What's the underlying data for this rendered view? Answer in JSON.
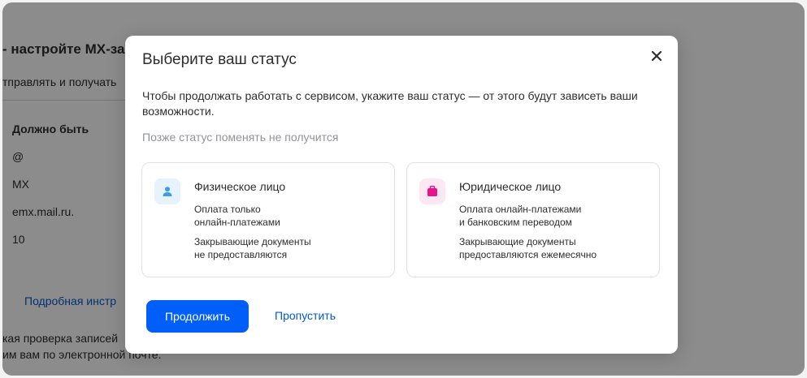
{
  "background": {
    "title": "- настройте MX-за",
    "subtitle": "тправлять и получать",
    "column_header": "Должно быть",
    "cells": [
      "@",
      "MX",
      "emx.mail.ru.",
      "10"
    ],
    "link": "Подробная инстр",
    "note_line1": "кая проверка записей",
    "note_line2": "им вам по электронной почте."
  },
  "modal": {
    "title": "Выберите ваш статус",
    "description": "Чтобы продолжать работать с сервисом, укажите ваш статус — от этого будут зависеть ваши возможности.",
    "hint": "Позже статус поменять не получится",
    "cards": [
      {
        "title": "Физическое лицо",
        "icon": "person-icon",
        "lines": [
          "Оплата только",
          "онлайн-платежами",
          "Закрывающие документы",
          "не предоставляются"
        ]
      },
      {
        "title": "Юридическое лицо",
        "icon": "briefcase-icon",
        "lines": [
          "Оплата онлайн-платежами",
          "и банковским переводом",
          "Закрывающие документы",
          "предоставляются ежемесячно"
        ]
      }
    ],
    "continue_label": "Продолжить",
    "skip_label": "Пропустить"
  },
  "colors": {
    "primary": "#005ff9",
    "link": "#005bd1",
    "person_icon": "#3e9ce6",
    "briefcase_icon": "#e6158c",
    "hint": "#919399"
  }
}
